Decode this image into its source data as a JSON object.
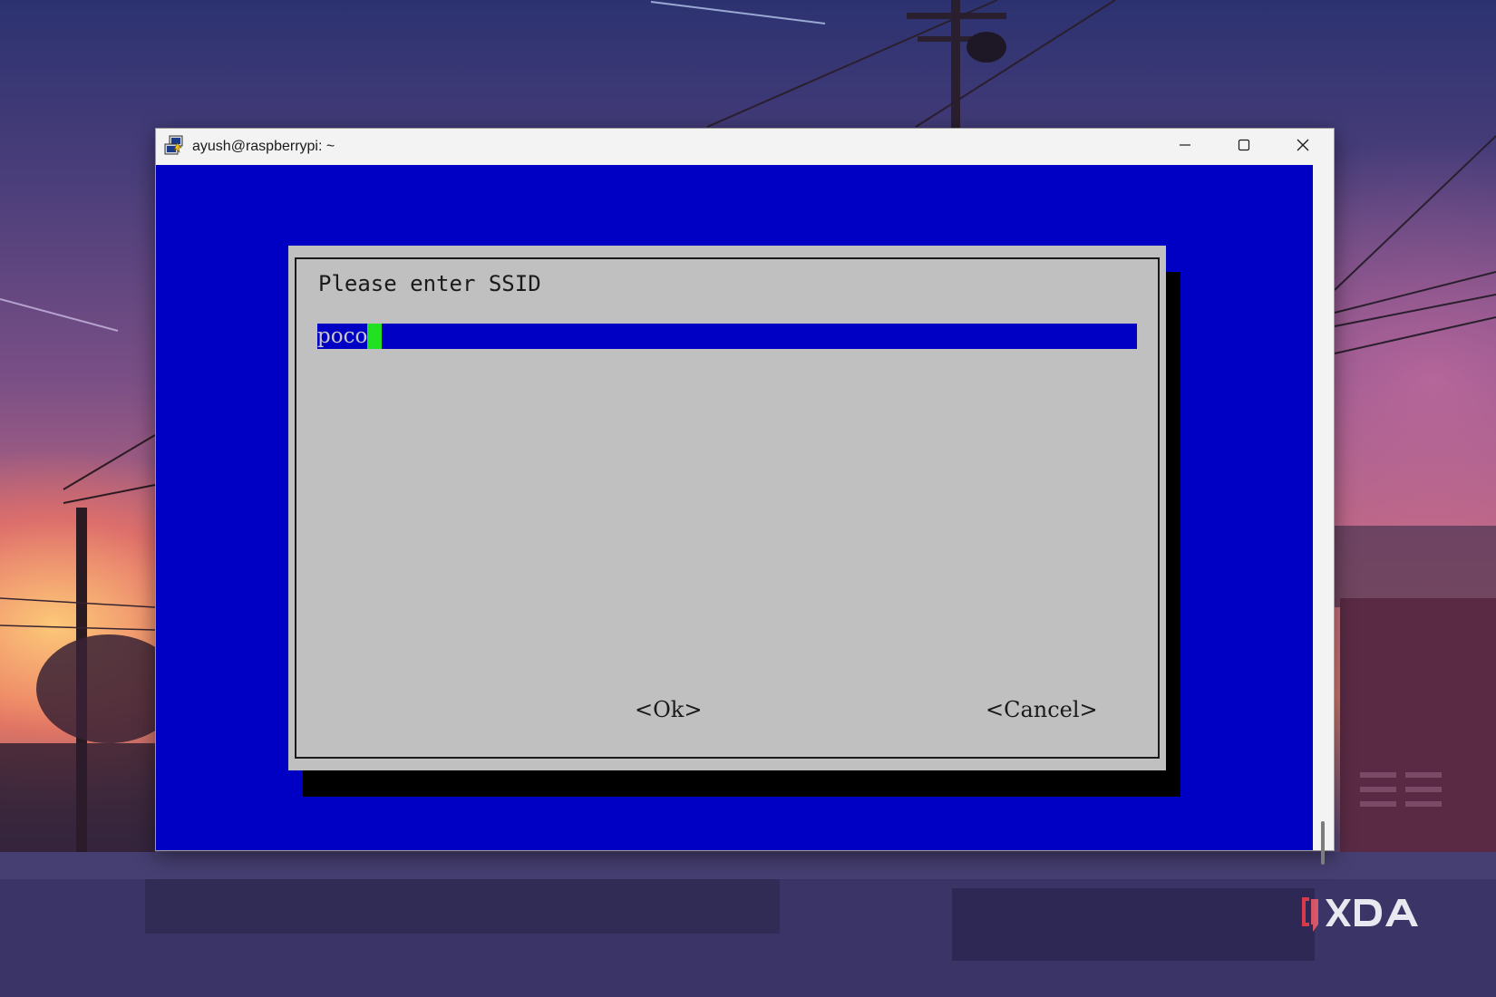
{
  "window": {
    "title": "ayush@raspberrypi: ~"
  },
  "dialog": {
    "prompt": "Please enter SSID",
    "input_value": "poco",
    "ok_label": "<Ok>",
    "cancel_label": "<Cancel>"
  },
  "icons": {
    "app": "putty-terminal-icon",
    "minimize": "minimize-icon",
    "maximize": "maximize-icon",
    "close": "close-icon"
  },
  "colors": {
    "terminal_bg": "#0000c4",
    "dialog_bg": "#c0c0c0",
    "cursor": "#22e022"
  }
}
